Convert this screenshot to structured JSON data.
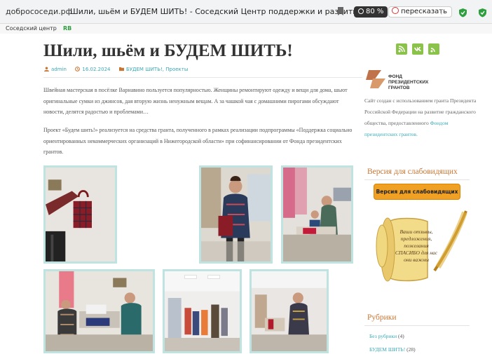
{
  "browser": {
    "url": "добрососеди.рф",
    "tab_title": "Шили, шьём и БУДЕМ ШИТЬ! - Соседский Центр поддержки и развития...",
    "reader_label": "80 %",
    "retell_label": "пересказать",
    "bookmark_1": "Соседский центр",
    "bookmark_2": "RB"
  },
  "post": {
    "title": "Шили, шьём и БУДЕМ ШИТЬ!",
    "author": "admin",
    "date": "16.02.2024",
    "categories": "БУДЕМ ШИТЬ!, Проекты",
    "paragraph_1": "Швейная мастерская в посёлке Варнавино пользуется популярностью. Женщины ремонтируют одежду и вещи для дома, шьют оригинальные сумки из джинсов, дая вторую жизнь ненужным вещам. А за чашкой чая с домашними пирогами обсуждают новости, делятся радостью и проблемами…",
    "paragraph_2": "Проект «Будем шить!» реализуется на средства гранта, полученного в рамках реализации подпрограммы «Поддержка социально ориентированных некоммерческих организаций в Нижегородской области» при софинансировании от Фонда президентских грантов."
  },
  "sidebar": {
    "grant_fund_logo": "ФОНД ПРЕЗИДЕНТСКИХ ГРАНТОВ",
    "grant_text": "Сайт создан с использованием гранта Президента Российской Федерации на развитие гражданского общества, предоставленного",
    "grant_link": "Фондом президентских грантов.",
    "impaired_title": "Версия для слабовидящих",
    "impaired_button": "Версия для слабовидящих",
    "scroll_text": "Ваши отзывы, предложения, пожелания СПАСИБО для нас они важны",
    "rubrics_title": "Рубрики",
    "rubrics": [
      {
        "name": "Без рубрики",
        "count": "(4)"
      },
      {
        "name": "БУДЕМ ШИТЬ!",
        "count": "(28)"
      }
    ]
  },
  "colors": {
    "accent_link": "#3aa9b5",
    "widget_title": "#c87533",
    "button_orange": "#f0a023",
    "social_green": "#8bc34a",
    "photo_border": "#bfe3e0"
  }
}
